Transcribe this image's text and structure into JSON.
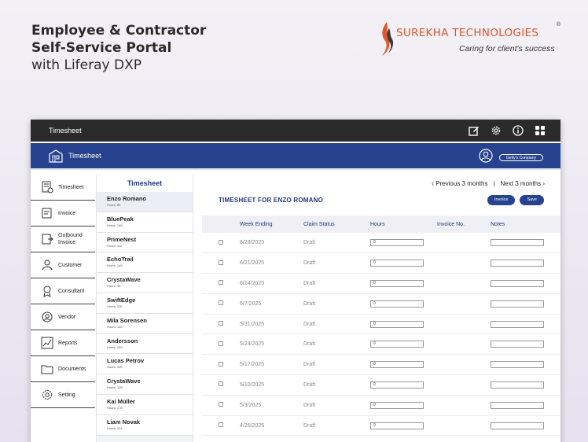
{
  "headline": {
    "line1": "Employee & Contractor",
    "line2": "Self-Service Portal",
    "line3": "with Liferay DXP"
  },
  "logo": {
    "brand": "SUREKHA TECHNOLOGIES",
    "registered": "®",
    "tagline": "Caring for client's success",
    "brand_color": "#e1572a"
  },
  "topbar": {
    "title": "Timesheet",
    "icons": [
      "edit-icon",
      "gear-icon",
      "info-icon",
      "grid-icon"
    ]
  },
  "header": {
    "home_label": "Timesheet",
    "company_label": "Getty's Company",
    "accent": "#27428f"
  },
  "sidebar": {
    "items": [
      {
        "label": "Timesheet",
        "icon": "timesheet-icon"
      },
      {
        "label": "Invoice",
        "icon": "invoice-icon"
      },
      {
        "label": "Outbound Invoice",
        "icon": "outbound-invoice-icon"
      },
      {
        "label": "Customer",
        "icon": "customer-icon"
      },
      {
        "label": "Consultant",
        "icon": "consultant-icon"
      },
      {
        "label": "Vendor",
        "icon": "vendor-icon"
      },
      {
        "label": "Reports",
        "icon": "reports-icon"
      },
      {
        "label": "Documents",
        "icon": "documents-icon"
      },
      {
        "label": "Setting",
        "icon": "setting-icon"
      }
    ]
  },
  "contractors": {
    "heading": "Timesheet",
    "items": [
      {
        "name": "Enzo Romano",
        "hours": "Hours: 80"
      },
      {
        "name": "BluePeak",
        "hours": "Hours: 109"
      },
      {
        "name": "PrimeNest",
        "hours": "Hours: 110"
      },
      {
        "name": "EchoTrail",
        "hours": "Hours: 145"
      },
      {
        "name": "CrystaWave",
        "hours": "Hours: 95"
      },
      {
        "name": "SwiftEdge",
        "hours": "Hours: 110"
      },
      {
        "name": "Mila Sorensen",
        "hours": "Hours: 145"
      },
      {
        "name": "Andersson",
        "hours": "Hours: 169"
      },
      {
        "name": "Lucas Petrov",
        "hours": "Hours: 105"
      },
      {
        "name": "CrystaWave",
        "hours": "Hours: 105"
      },
      {
        "name": "Kai Müller",
        "hours": "Hours: 178"
      },
      {
        "name": "Liam Novak",
        "hours": "Hours: 124"
      }
    ]
  },
  "main": {
    "prev_label": "Previous 3 months",
    "next_label": "Next 3 months",
    "title": "TIMESHEET FOR ENZO ROMANO",
    "invoice_button": "Invoice",
    "save_button": "Save",
    "columns": [
      "Week Ending",
      "Claim Status",
      "Hours",
      "Invoice No.",
      "Notes"
    ],
    "rows": [
      {
        "week": "6/28/2025",
        "status": "Draft",
        "hours": "0"
      },
      {
        "week": "6/21/2025",
        "status": "Draft",
        "hours": "0"
      },
      {
        "week": "6/14/2025",
        "status": "Draft",
        "hours": "0"
      },
      {
        "week": "6/7/2025",
        "status": "Draft",
        "hours": "0"
      },
      {
        "week": "5/31/2025",
        "status": "Draft",
        "hours": "0"
      },
      {
        "week": "5/24/2025",
        "status": "Draft",
        "hours": "0"
      },
      {
        "week": "5/17/2025",
        "status": "Draft",
        "hours": "0"
      },
      {
        "week": "5/10/2025",
        "status": "Draft",
        "hours": "0"
      },
      {
        "week": "5/3/2025",
        "status": "Draft",
        "hours": "0"
      },
      {
        "week": "4/26/2025",
        "status": "Draft",
        "hours": "0"
      }
    ]
  }
}
